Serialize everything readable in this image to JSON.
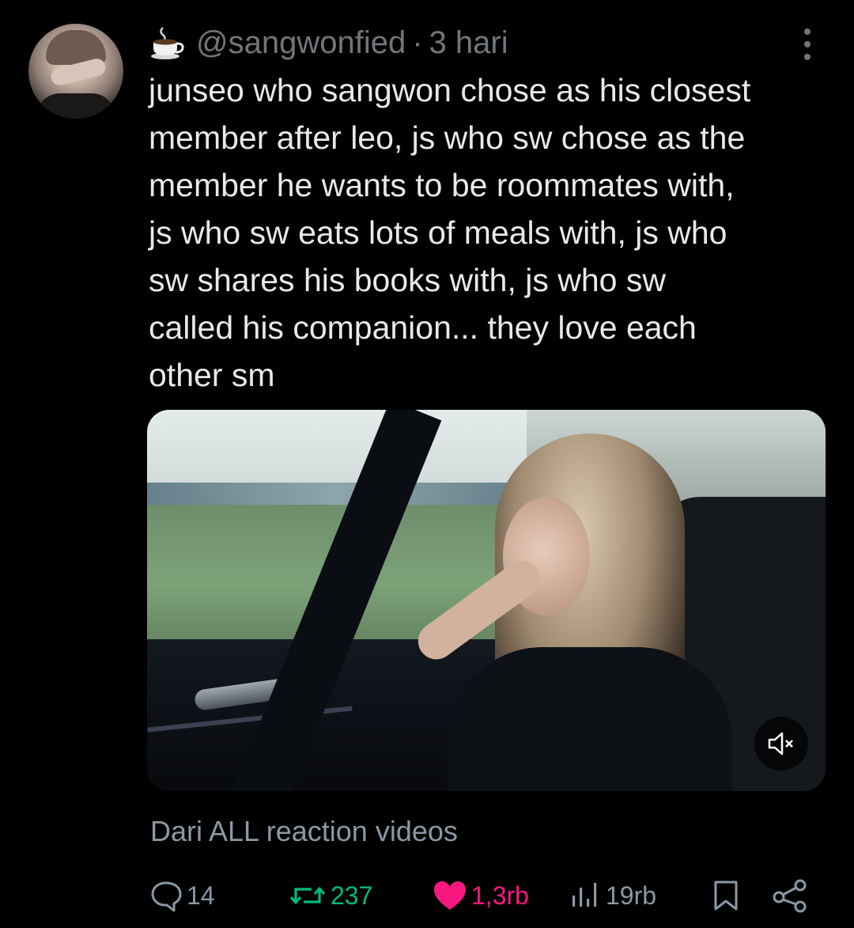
{
  "tweet": {
    "author_handle": "@sangwonfied",
    "separator": "·",
    "time_ago": "3 hari",
    "text": "junseo who sangwon chose as his closest\nmember after leo, js who sw chose as the\nmember he wants to be roommates with,\njs who sw eats lots of meals with, js who\nsw shares his books with, js who sw\ncalled his companion... they love each\nother sm",
    "source_line": "Dari ALL reaction videos"
  },
  "icons": {
    "name_emoji": "coffee-cup-icon",
    "more": "more-options-icon",
    "mute": "muted-speaker-icon",
    "reply": "reply-icon",
    "retweet": "retweet-icon",
    "like": "heart-icon",
    "views": "views-icon",
    "bookmark": "bookmark-icon",
    "share": "share-icon"
  },
  "metrics": {
    "replies": "14",
    "retweets": "237",
    "likes": "1,3rb",
    "views": "19rb"
  },
  "colors": {
    "background": "#000000",
    "text_primary": "#e7e9ea",
    "text_secondary": "#71767b",
    "retweet_active": "#00ba7c",
    "like_active": "#f91880"
  }
}
